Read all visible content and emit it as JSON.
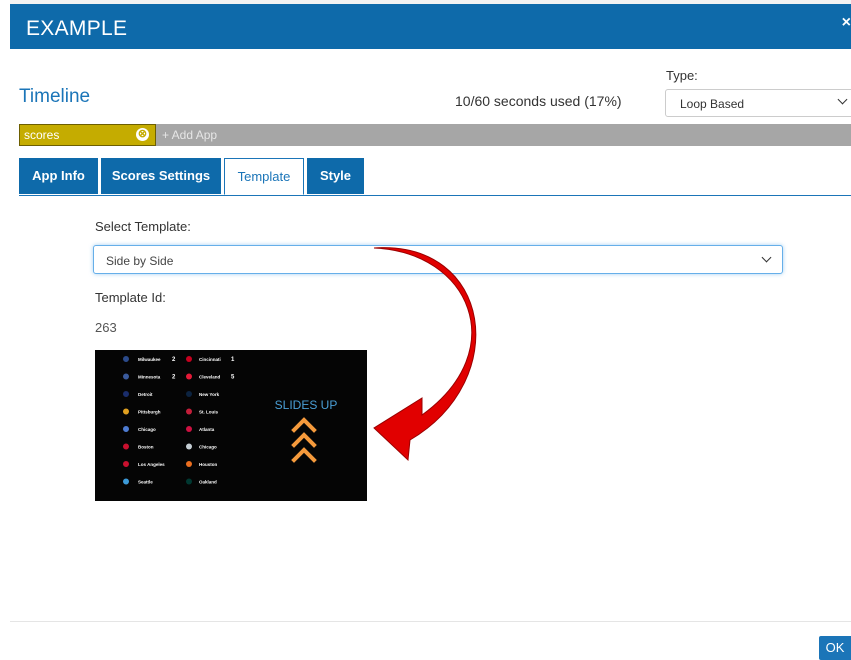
{
  "modal": {
    "title": "EXAMPLE",
    "close_glyph": "×"
  },
  "timeline": {
    "title": "Timeline",
    "seconds_used": "10/60 seconds used (17%)"
  },
  "type": {
    "label": "Type:",
    "selected": "Loop Based"
  },
  "apps": {
    "chip_label": "scores",
    "chip_remove_glyph": "⊗",
    "add_label": "+ Add App"
  },
  "tabs": [
    {
      "label": "App Info",
      "active": false
    },
    {
      "label": "Scores Settings",
      "active": false
    },
    {
      "label": "Template",
      "active": true
    },
    {
      "label": "Style",
      "active": false
    }
  ],
  "template": {
    "select_label": "Select Template:",
    "selected": "Side by Side",
    "id_label": "Template Id:",
    "id_value": "263"
  },
  "preview": {
    "slides_up_label": "SLIDES UP",
    "games": [
      {
        "away": "Milwaukee",
        "away_score": "2",
        "home": "Cincinnati",
        "home_score": "1"
      },
      {
        "away": "Minnesota",
        "away_score": "2",
        "home": "Cleveland",
        "home_score": "5"
      },
      {
        "away": "Detroit",
        "away_score": "",
        "home": "New York",
        "home_score": ""
      },
      {
        "away": "Pittsburgh",
        "away_score": "",
        "home": "St. Louis",
        "home_score": ""
      },
      {
        "away": "Chicago",
        "away_score": "",
        "home": "Atlanta",
        "home_score": ""
      },
      {
        "away": "Boston",
        "away_score": "",
        "home": "Chicago",
        "home_score": ""
      },
      {
        "away": "Los Angeles",
        "away_score": "",
        "home": "Houston",
        "home_score": ""
      },
      {
        "away": "Seattle",
        "away_score": "",
        "home": "Oakland",
        "home_score": ""
      }
    ],
    "colors": {
      "background": "#050505",
      "text": "#ffffff",
      "slides_up": "#4a9fd6",
      "chevrons": "#f59a3c"
    }
  },
  "colors": {
    "header": "#0e6aaa",
    "accent": "#1b75b8",
    "chip": "#c5ac00",
    "appbar": "#a6a6a6",
    "arrow": "#e10000"
  },
  "footer": {
    "ok_label": "OK"
  }
}
